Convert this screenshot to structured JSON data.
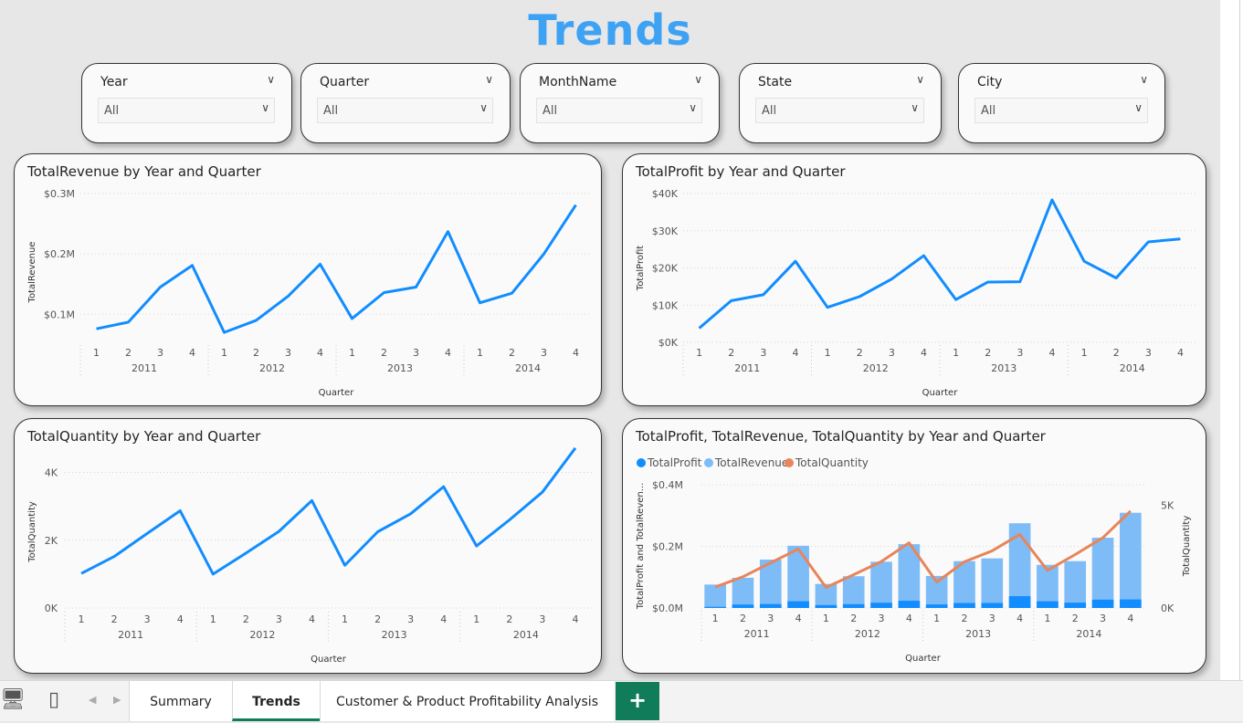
{
  "page": {
    "title": "Trends"
  },
  "slicers": [
    {
      "label": "Year",
      "value": "All"
    },
    {
      "label": "Quarter",
      "value": "All"
    },
    {
      "label": "MonthName",
      "value": "All"
    },
    {
      "label": "State",
      "value": "All"
    },
    {
      "label": "City",
      "value": "All"
    }
  ],
  "charts": {
    "revenue": {
      "title": "TotalRevenue by Year and Quarter",
      "ylabel": "TotalRevenue",
      "xlabel": "Quarter",
      "yticks": [
        "$0.1M",
        "$0.2M",
        "$0.3M"
      ]
    },
    "profit": {
      "title": "TotalProfit by Year and Quarter",
      "ylabel": "TotalProfit",
      "xlabel": "Quarter",
      "yticks": [
        "$0K",
        "$10K",
        "$20K",
        "$30K",
        "$40K"
      ]
    },
    "quantity": {
      "title": "TotalQuantity by Year and Quarter",
      "ylabel": "TotalQuantity",
      "xlabel": "Quarter",
      "yticks": [
        "0K",
        "2K",
        "4K"
      ]
    },
    "combo": {
      "title": "TotalProfit, TotalRevenue, TotalQuantity by Year and Quarter",
      "ylabel": "TotalProfit and TotalReven...",
      "y2label": "TotalQuantity",
      "xlabel": "Quarter",
      "yticks": [
        "$0.0M",
        "$0.2M",
        "$0.4M"
      ],
      "y2ticks": [
        "0K",
        "5K"
      ],
      "legend": [
        "TotalProfit",
        "TotalRevenue",
        "TotalQuantity"
      ]
    }
  },
  "chart_data": [
    {
      "type": "line",
      "title": "TotalRevenue by Year and Quarter",
      "xlabel": "Quarter",
      "ylabel": "TotalRevenue",
      "quarters": [
        "1",
        "2",
        "3",
        "4",
        "1",
        "2",
        "3",
        "4",
        "1",
        "2",
        "3",
        "4",
        "1",
        "2",
        "3",
        "4"
      ],
      "years": [
        "2011",
        "2012",
        "2013",
        "2014"
      ],
      "series": [
        {
          "name": "TotalRevenue",
          "values": [
            76000,
            87000,
            145000,
            181000,
            70000,
            90000,
            130000,
            183000,
            93000,
            136000,
            145000,
            237000,
            119000,
            135000,
            200000,
            281000
          ]
        }
      ],
      "ylim": [
        0.04,
        0.3
      ],
      "yunit": "$M",
      "grid": true
    },
    {
      "type": "line",
      "title": "TotalProfit by Year and Quarter",
      "xlabel": "Quarter",
      "ylabel": "TotalProfit",
      "quarters": [
        "1",
        "2",
        "3",
        "4",
        "1",
        "2",
        "3",
        "4",
        "1",
        "2",
        "3",
        "4",
        "1",
        "2",
        "3",
        "4"
      ],
      "years": [
        "2011",
        "2012",
        "2013",
        "2014"
      ],
      "series": [
        {
          "name": "TotalProfit",
          "values": [
            3800,
            11200,
            12800,
            21800,
            9400,
            12300,
            17000,
            23300,
            11500,
            16200,
            16300,
            38300,
            21800,
            17300,
            27000,
            27800
          ]
        }
      ],
      "ylim": [
        0,
        40000
      ],
      "grid": true
    },
    {
      "type": "line",
      "title": "TotalQuantity by Year and Quarter",
      "xlabel": "Quarter",
      "ylabel": "TotalQuantity",
      "quarters": [
        "1",
        "2",
        "3",
        "4",
        "1",
        "2",
        "3",
        "4",
        "1",
        "2",
        "3",
        "4",
        "1",
        "2",
        "3",
        "4"
      ],
      "years": [
        "2011",
        "2012",
        "2013",
        "2014"
      ],
      "series": [
        {
          "name": "TotalQuantity",
          "values": [
            1020,
            1520,
            2200,
            2870,
            1000,
            1620,
            2260,
            3170,
            1260,
            2250,
            2780,
            3580,
            1830,
            2600,
            3420,
            4720
          ]
        }
      ],
      "ylim": [
        0,
        4500
      ],
      "grid": true
    },
    {
      "type": "bar",
      "title": "TotalProfit, TotalRevenue, TotalQuantity by Year and Quarter",
      "xlabel": "Quarter",
      "ylabel": "TotalProfit and TotalReven...",
      "y2label": "TotalQuantity",
      "quarters": [
        "1",
        "2",
        "3",
        "4",
        "1",
        "2",
        "3",
        "4",
        "1",
        "2",
        "3",
        "4",
        "1",
        "2",
        "3",
        "4"
      ],
      "years": [
        "2011",
        "2012",
        "2013",
        "2014"
      ],
      "series": [
        {
          "name": "TotalProfit",
          "kind": "bar",
          "values": [
            3800,
            11200,
            12800,
            21800,
            9400,
            12300,
            17000,
            23300,
            11500,
            16200,
            16300,
            38300,
            21800,
            17300,
            27000,
            27800
          ]
        },
        {
          "name": "TotalRevenue",
          "kind": "bar",
          "values": [
            76000,
            98000,
            157000,
            202000,
            78000,
            103000,
            150000,
            207000,
            104000,
            152000,
            161000,
            275000,
            140000,
            152000,
            228000,
            309000
          ]
        },
        {
          "name": "TotalQuantity",
          "kind": "line",
          "axis": "secondary",
          "values": [
            1020,
            1520,
            2200,
            2870,
            1000,
            1620,
            2260,
            3170,
            1260,
            2250,
            2780,
            3580,
            1830,
            2600,
            3420,
            4720
          ]
        }
      ],
      "ylim": [
        0,
        400000
      ],
      "y2lim": [
        0,
        6000
      ],
      "grid": true,
      "legend": "top-left",
      "colors": {
        "TotalProfit": "#118dff",
        "TotalRevenue": "#7dbcf7",
        "TotalQuantity": "#e8855a"
      }
    }
  ],
  "tabs": [
    {
      "label": "Summary",
      "active": false
    },
    {
      "label": "Trends",
      "active": true
    },
    {
      "label": "Customer & Product Profitability Analysis",
      "active": false
    }
  ],
  "add_tab_label": "+",
  "colors": {
    "title": "#3ea2f4",
    "line": "#118dff",
    "tab_accent": "#107c5a"
  }
}
